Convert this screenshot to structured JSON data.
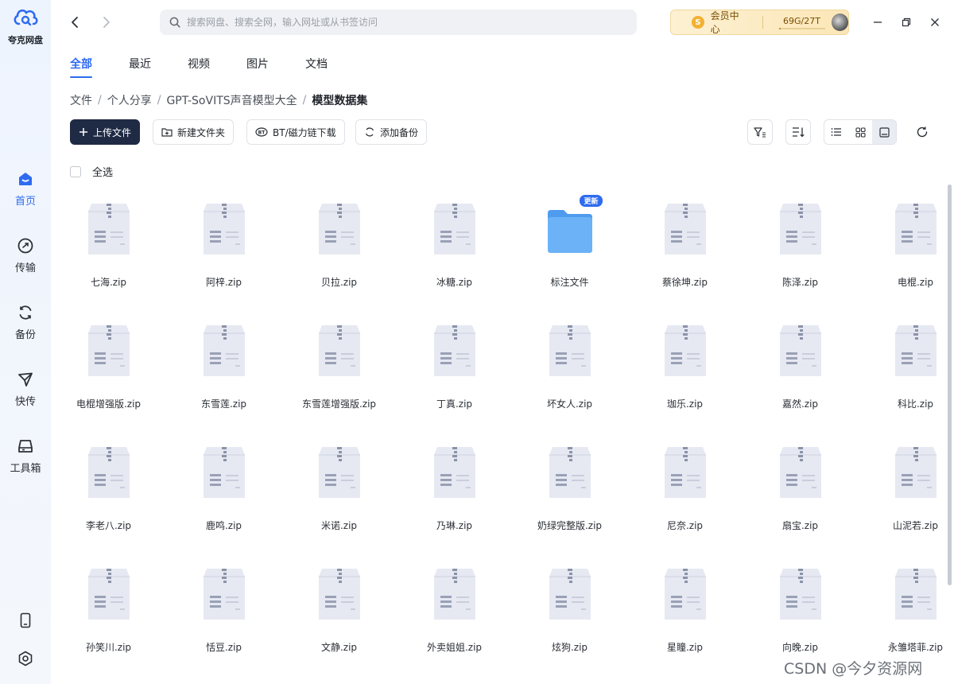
{
  "app": {
    "name": "夸克网盘"
  },
  "sidebar": {
    "items": [
      {
        "label": "首页",
        "icon": "home-icon",
        "active": true
      },
      {
        "label": "传输",
        "icon": "transfer-icon",
        "active": false
      },
      {
        "label": "备份",
        "icon": "backup-icon",
        "active": false
      },
      {
        "label": "快传",
        "icon": "quick-send-icon",
        "active": false
      },
      {
        "label": "工具箱",
        "icon": "toolbox-icon",
        "active": false
      }
    ],
    "bottom_icons": [
      "phone-icon",
      "settings-icon"
    ]
  },
  "search": {
    "placeholder": "搜索网盘、搜索全网，输入网址或从书签访问",
    "value": ""
  },
  "vip": {
    "label": "会员中心",
    "coin": "S",
    "quota": "69G/27T",
    "quota_fraction": 0.05
  },
  "tabs": [
    {
      "label": "全部",
      "active": true
    },
    {
      "label": "最近",
      "active": false
    },
    {
      "label": "视频",
      "active": false
    },
    {
      "label": "图片",
      "active": false
    },
    {
      "label": "文档",
      "active": false
    }
  ],
  "breadcrumb": [
    "文件",
    "个人分享",
    "GPT-SoVITS声音模型大全",
    "模型数据集"
  ],
  "toolbar": {
    "upload": "上传文件",
    "new_folder": "新建文件夹",
    "bt_download": "BT/磁力链下载",
    "add_backup": "添加备份"
  },
  "select_all": "全选",
  "folder_badge": "更新",
  "files": [
    {
      "name": "七海.zip",
      "type": "zip"
    },
    {
      "name": "阿梓.zip",
      "type": "zip"
    },
    {
      "name": "贝拉.zip",
      "type": "zip"
    },
    {
      "name": "冰糖.zip",
      "type": "zip"
    },
    {
      "name": "标注文件",
      "type": "folder"
    },
    {
      "name": "蔡徐坤.zip",
      "type": "zip"
    },
    {
      "name": "陈泽.zip",
      "type": "zip"
    },
    {
      "name": "电棍.zip",
      "type": "zip"
    },
    {
      "name": "电棍增强版.zip",
      "type": "zip"
    },
    {
      "name": "东雪莲.zip",
      "type": "zip"
    },
    {
      "name": "东雪莲增强版.zip",
      "type": "zip"
    },
    {
      "name": "丁真.zip",
      "type": "zip"
    },
    {
      "name": "坏女人.zip",
      "type": "zip"
    },
    {
      "name": "珈乐.zip",
      "type": "zip"
    },
    {
      "name": "嘉然.zip",
      "type": "zip"
    },
    {
      "name": "科比.zip",
      "type": "zip"
    },
    {
      "name": "李老八.zip",
      "type": "zip"
    },
    {
      "name": "鹿鸣.zip",
      "type": "zip"
    },
    {
      "name": "米诺.zip",
      "type": "zip"
    },
    {
      "name": "乃琳.zip",
      "type": "zip"
    },
    {
      "name": "奶绿完整版.zip",
      "type": "zip"
    },
    {
      "name": "尼奈.zip",
      "type": "zip"
    },
    {
      "name": "扇宝.zip",
      "type": "zip"
    },
    {
      "name": "山泥若.zip",
      "type": "zip"
    },
    {
      "name": "孙笑川.zip",
      "type": "zip"
    },
    {
      "name": "恬豆.zip",
      "type": "zip"
    },
    {
      "name": "文静.zip",
      "type": "zip"
    },
    {
      "name": "外卖姐姐.zip",
      "type": "zip"
    },
    {
      "name": "炫狗.zip",
      "type": "zip"
    },
    {
      "name": "星瞳.zip",
      "type": "zip"
    },
    {
      "name": "向晚.zip",
      "type": "zip"
    },
    {
      "name": "永雏塔菲.zip",
      "type": "zip"
    }
  ],
  "watermark": "CSDN @今夕资源网",
  "colors": {
    "accent": "#2e6bf0",
    "upload_button": "#1f2a44",
    "vip_bg": "#fbe6b7",
    "folder": "#5aa7f5"
  }
}
